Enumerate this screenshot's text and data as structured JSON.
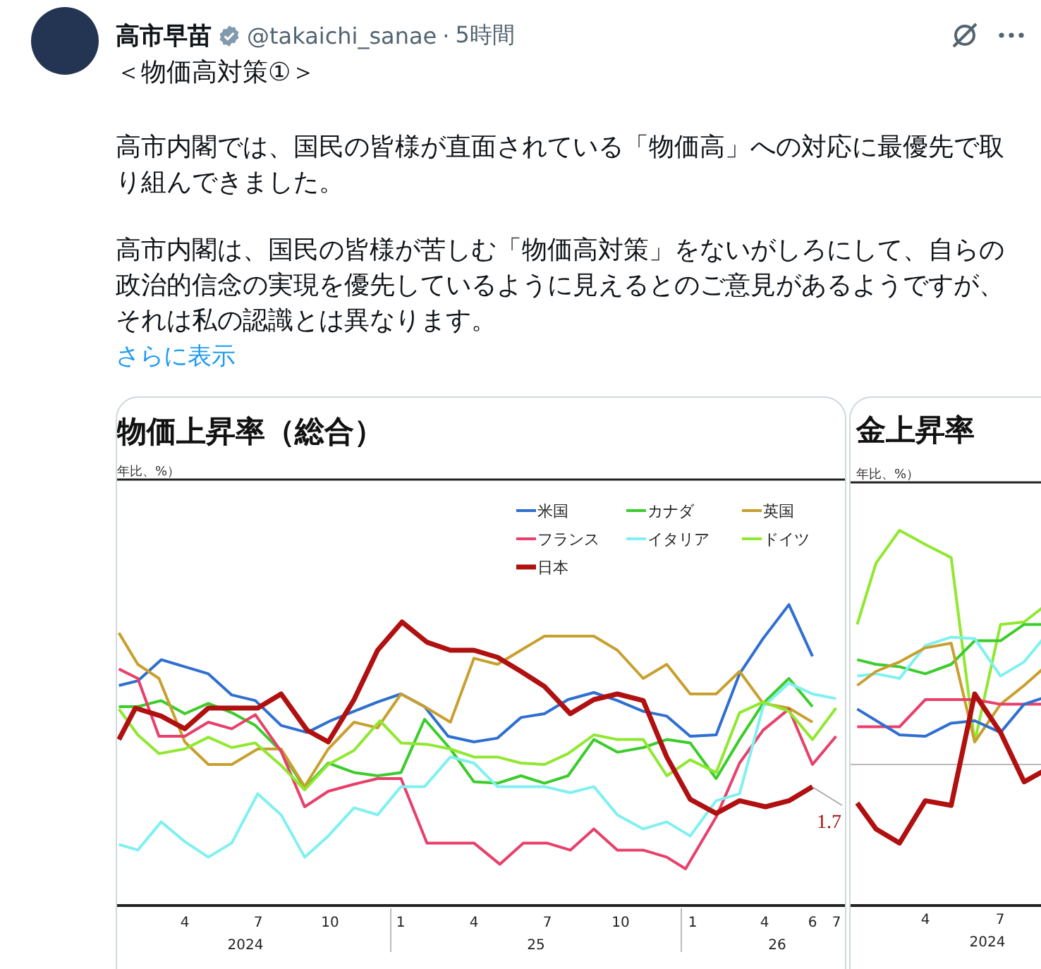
{
  "post": {
    "author": {
      "name": "高市早苗",
      "handle": "@takaichi_sanae",
      "separator": "·",
      "time": "5時間"
    },
    "title": "＜物価高対策①＞",
    "paragraphs": [
      "高市内閣では、国民の皆様が直面されている「物価高」への対応に最優先で取り組んできました。",
      "高市内閣は、国民の皆様が苦しむ「物価高対策」をないがしろにして、自らの政治的信念の実現を優先しているように見えるとのご意見があるようですが、それは私の認識とは異なります。"
    ],
    "show_more": "さらに表示"
  },
  "images": [
    {
      "chart": {
        "title": "物価上昇率（総合）",
        "unit": "年比、%）",
        "legend": [
          {
            "label": "米国",
            "color": "#2f6fd0"
          },
          {
            "label": "カナダ",
            "color": "#3ccc2c"
          },
          {
            "label": "英国",
            "color": "#c8a030"
          },
          {
            "label": "フランス",
            "color": "#e8406a"
          },
          {
            "label": "イタリア",
            "color": "#80f0f0"
          },
          {
            "label": "ドイツ",
            "color": "#90e830"
          },
          {
            "label": "日本",
            "color": "#b01010"
          }
        ],
        "x_ticks": [
          "4",
          "7",
          "10",
          "1",
          "4",
          "7",
          "10",
          "1",
          "4",
          "6",
          "7"
        ],
        "years": [
          "2024",
          "25",
          "26"
        ],
        "end_label": "1.7"
      }
    },
    {
      "chart": {
        "title": "金上昇率",
        "unit": "年比、%）",
        "x_ticks": [
          "4",
          "7"
        ],
        "years": [
          "2024"
        ]
      }
    }
  ]
}
